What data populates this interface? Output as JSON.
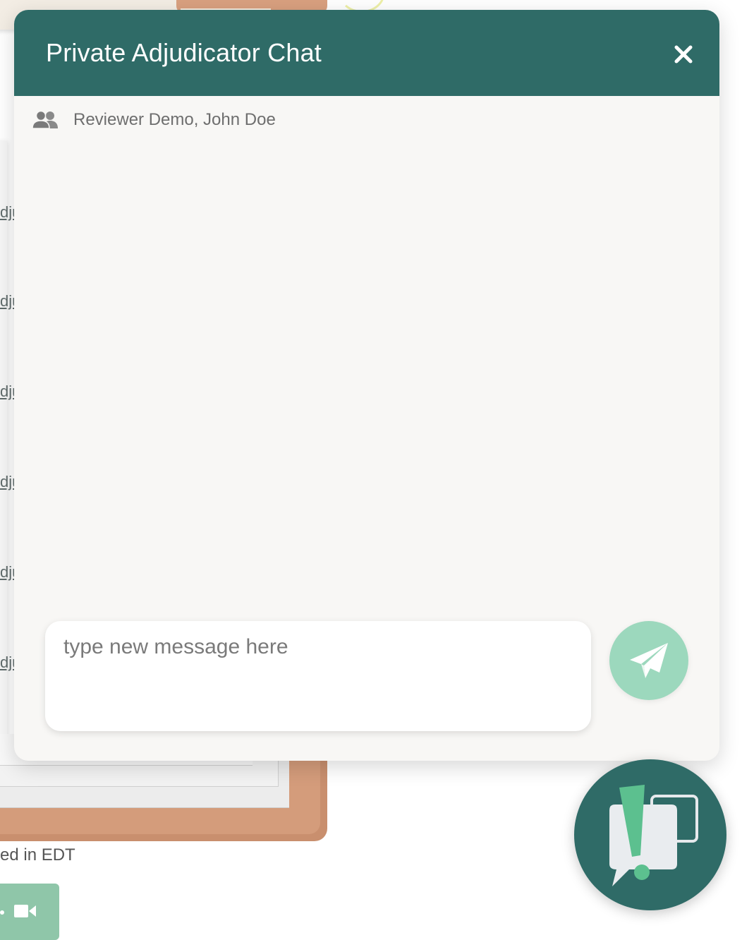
{
  "chat": {
    "title": "Private Adjudicator Chat",
    "participants": "Reviewer Demo, John Doe",
    "message_placeholder": "type new message here",
    "icons": {
      "close": "close-icon",
      "participants": "users-icon",
      "send": "paper-plane-icon",
      "launcher": "chat-alert-icon"
    }
  },
  "background": {
    "links": [
      "dju",
      "dju",
      "dju",
      "dju",
      "dju",
      "dju"
    ],
    "timezone_text": "ed in EDT"
  },
  "colors": {
    "header": "#2f6b67",
    "panel": "#f8f7f5",
    "send_button": "#9cd8bd",
    "accent_green": "#5cc08f"
  }
}
